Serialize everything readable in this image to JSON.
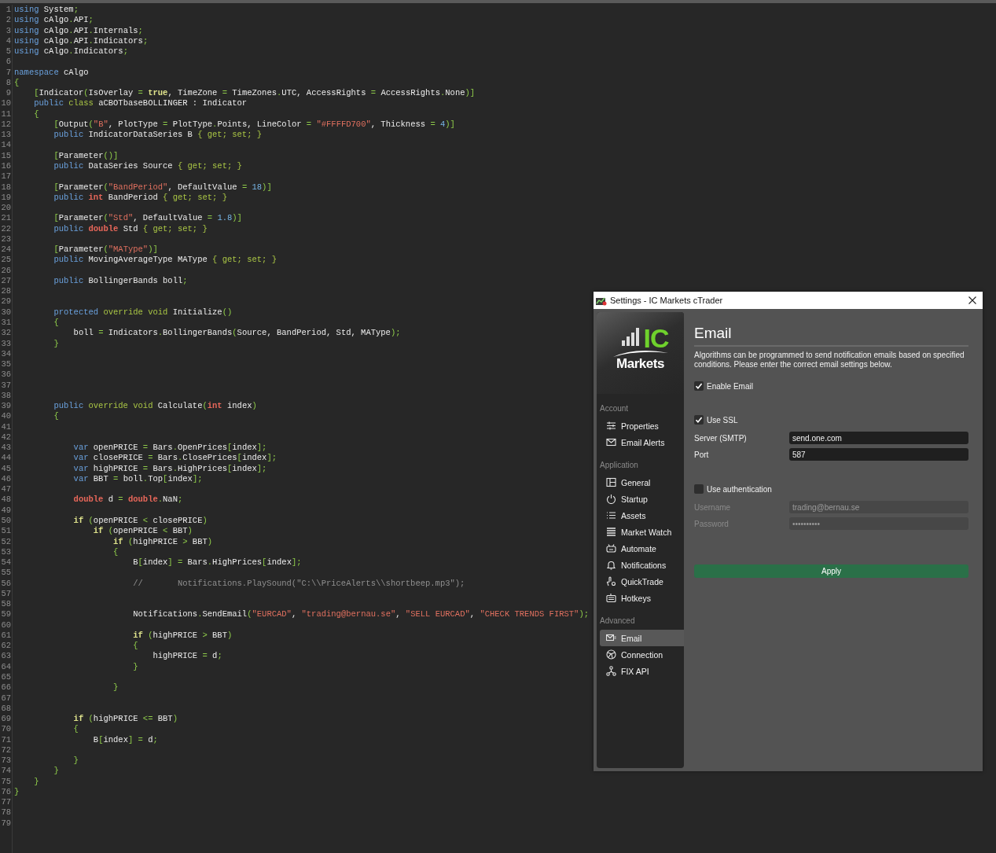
{
  "editor": {
    "lines": [
      {
        "number": "1",
        "segments": [
          {
            "kind": "kw",
            "text": "using"
          },
          {
            "kind": "txt",
            "text": " System"
          },
          {
            "kind": "pun",
            "text": ";"
          }
        ]
      },
      {
        "number": "2",
        "segments": [
          {
            "kind": "kw",
            "text": "using"
          },
          {
            "kind": "txt",
            "text": " cAlgo"
          },
          {
            "kind": "pun",
            "text": "."
          },
          {
            "kind": "txt",
            "text": "API"
          },
          {
            "kind": "pun",
            "text": ";"
          }
        ]
      },
      {
        "number": "3",
        "segments": [
          {
            "kind": "kw",
            "text": "using"
          },
          {
            "kind": "txt",
            "text": " cAlgo"
          },
          {
            "kind": "pun",
            "text": "."
          },
          {
            "kind": "txt",
            "text": "API"
          },
          {
            "kind": "pun",
            "text": "."
          },
          {
            "kind": "txt",
            "text": "Internals"
          },
          {
            "kind": "pun",
            "text": ";"
          }
        ]
      },
      {
        "number": "4",
        "segments": [
          {
            "kind": "kw",
            "text": "using"
          },
          {
            "kind": "txt",
            "text": " cAlgo"
          },
          {
            "kind": "pun",
            "text": "."
          },
          {
            "kind": "txt",
            "text": "API"
          },
          {
            "kind": "pun",
            "text": "."
          },
          {
            "kind": "txt",
            "text": "Indicators"
          },
          {
            "kind": "pun",
            "text": ";"
          }
        ]
      },
      {
        "number": "5",
        "segments": [
          {
            "kind": "kw",
            "text": "using"
          },
          {
            "kind": "txt",
            "text": " cAlgo"
          },
          {
            "kind": "pun",
            "text": "."
          },
          {
            "kind": "txt",
            "text": "Indicators"
          },
          {
            "kind": "pun",
            "text": ";"
          }
        ]
      },
      {
        "number": "6"
      },
      {
        "number": "7",
        "segments": [
          {
            "kind": "kw",
            "text": "namespace"
          },
          {
            "kind": "txt",
            "text": " cAlgo"
          }
        ]
      },
      {
        "number": "8",
        "segments": [
          {
            "kind": "pun",
            "text": "{"
          }
        ]
      },
      {
        "number": "9",
        "segments": [
          {
            "kind": "pun",
            "text": "    ["
          },
          {
            "kind": "txt",
            "text": "Indicator"
          },
          {
            "kind": "pun",
            "text": "("
          },
          {
            "kind": "txt",
            "text": "IsOverlay "
          },
          {
            "kind": "pun",
            "text": "= "
          },
          {
            "kind": "ctl",
            "text": "true"
          },
          {
            "kind": "txt",
            "text": ", TimeZone "
          },
          {
            "kind": "pun",
            "text": "="
          },
          {
            "kind": "txt",
            "text": " TimeZones"
          },
          {
            "kind": "pun",
            "text": "."
          },
          {
            "kind": "txt",
            "text": "UTC, AccessRights "
          },
          {
            "kind": "pun",
            "text": "="
          },
          {
            "kind": "txt",
            "text": " AccessRights"
          },
          {
            "kind": "pun",
            "text": "."
          },
          {
            "kind": "txt",
            "text": "None"
          },
          {
            "kind": "pun",
            "text": ")]"
          }
        ]
      },
      {
        "number": "10",
        "segments": [
          {
            "kind": "kw",
            "text": "    public "
          },
          {
            "kind": "kw2",
            "text": "class"
          },
          {
            "kind": "txt",
            "text": " aCBOTbaseBOLLINGER : Indicator"
          }
        ]
      },
      {
        "number": "11",
        "segments": [
          {
            "kind": "pun",
            "text": "    {"
          }
        ]
      },
      {
        "number": "12",
        "segments": [
          {
            "kind": "pun",
            "text": "        ["
          },
          {
            "kind": "txt",
            "text": "Output"
          },
          {
            "kind": "pun",
            "text": "("
          },
          {
            "kind": "str",
            "text": "\"B\""
          },
          {
            "kind": "txt",
            "text": ", PlotType "
          },
          {
            "kind": "pun",
            "text": "="
          },
          {
            "kind": "txt",
            "text": " PlotType"
          },
          {
            "kind": "pun",
            "text": "."
          },
          {
            "kind": "txt",
            "text": "Points, LineColor "
          },
          {
            "kind": "pun",
            "text": "= "
          },
          {
            "kind": "str",
            "text": "\"#FFFFD700\""
          },
          {
            "kind": "txt",
            "text": ", Thickness "
          },
          {
            "kind": "pun",
            "text": "= "
          },
          {
            "kind": "num",
            "text": "4"
          },
          {
            "kind": "pun",
            "text": ")]"
          }
        ]
      },
      {
        "number": "13",
        "segments": [
          {
            "kind": "kw",
            "text": "        public"
          },
          {
            "kind": "txt",
            "text": " IndicatorDataSeries B "
          },
          {
            "kind": "kw2",
            "text": "{ get; set; }"
          }
        ]
      },
      {
        "number": "14"
      },
      {
        "number": "15",
        "segments": [
          {
            "kind": "pun",
            "text": "        ["
          },
          {
            "kind": "txt",
            "text": "Parameter"
          },
          {
            "kind": "pun",
            "text": "()]"
          }
        ]
      },
      {
        "number": "16",
        "segments": [
          {
            "kind": "kw",
            "text": "        public"
          },
          {
            "kind": "txt",
            "text": " DataSeries Source "
          },
          {
            "kind": "kw2",
            "text": "{ get; set; }"
          }
        ]
      },
      {
        "number": "17"
      },
      {
        "number": "18",
        "segments": [
          {
            "kind": "pun",
            "text": "        ["
          },
          {
            "kind": "txt",
            "text": "Parameter"
          },
          {
            "kind": "pun",
            "text": "("
          },
          {
            "kind": "str",
            "text": "\"BandPeriod\""
          },
          {
            "kind": "txt",
            "text": ", DefaultValue "
          },
          {
            "kind": "pun",
            "text": "= "
          },
          {
            "kind": "num",
            "text": "18"
          },
          {
            "kind": "pun",
            "text": ")]"
          }
        ]
      },
      {
        "number": "19",
        "segments": [
          {
            "kind": "kw",
            "text": "        public "
          },
          {
            "kind": "type",
            "text": "int"
          },
          {
            "kind": "txt",
            "text": " BandPeriod "
          },
          {
            "kind": "kw2",
            "text": "{ get; set; }"
          }
        ]
      },
      {
        "number": "20"
      },
      {
        "number": "21",
        "segments": [
          {
            "kind": "pun",
            "text": "        ["
          },
          {
            "kind": "txt",
            "text": "Parameter"
          },
          {
            "kind": "pun",
            "text": "("
          },
          {
            "kind": "str",
            "text": "\"Std\""
          },
          {
            "kind": "txt",
            "text": ", DefaultValue "
          },
          {
            "kind": "pun",
            "text": "= "
          },
          {
            "kind": "num",
            "text": "1.8"
          },
          {
            "kind": "pun",
            "text": ")]"
          }
        ]
      },
      {
        "number": "22",
        "segments": [
          {
            "kind": "kw",
            "text": "        public "
          },
          {
            "kind": "type",
            "text": "double"
          },
          {
            "kind": "txt",
            "text": " Std "
          },
          {
            "kind": "kw2",
            "text": "{ get; set; }"
          }
        ]
      },
      {
        "number": "23"
      },
      {
        "number": "24",
        "segments": [
          {
            "kind": "pun",
            "text": "        ["
          },
          {
            "kind": "txt",
            "text": "Parameter"
          },
          {
            "kind": "pun",
            "text": "("
          },
          {
            "kind": "str",
            "text": "\"MAType\""
          },
          {
            "kind": "pun",
            "text": ")]"
          }
        ]
      },
      {
        "number": "25",
        "segments": [
          {
            "kind": "kw",
            "text": "        public"
          },
          {
            "kind": "txt",
            "text": " MovingAverageType MAType "
          },
          {
            "kind": "kw2",
            "text": "{ get; set; }"
          }
        ]
      },
      {
        "number": "26"
      },
      {
        "number": "27",
        "segments": [
          {
            "kind": "kw",
            "text": "        public"
          },
          {
            "kind": "txt",
            "text": " BollingerBands boll"
          },
          {
            "kind": "pun",
            "text": ";"
          }
        ]
      },
      {
        "number": "28"
      },
      {
        "number": "29"
      },
      {
        "number": "30",
        "segments": [
          {
            "kind": "kw",
            "text": "        protected "
          },
          {
            "kind": "kw2",
            "text": "override void"
          },
          {
            "kind": "txt",
            "text": " Initialize"
          },
          {
            "kind": "pun",
            "text": "()"
          }
        ]
      },
      {
        "number": "31",
        "segments": [
          {
            "kind": "pun",
            "text": "        {"
          }
        ]
      },
      {
        "number": "32",
        "segments": [
          {
            "kind": "txt",
            "text": "            boll "
          },
          {
            "kind": "pun",
            "text": "="
          },
          {
            "kind": "txt",
            "text": " Indicators"
          },
          {
            "kind": "pun",
            "text": "."
          },
          {
            "kind": "txt",
            "text": "BollingerBands"
          },
          {
            "kind": "pun",
            "text": "("
          },
          {
            "kind": "txt",
            "text": "Source, BandPeriod, Std, MAType"
          },
          {
            "kind": "pun",
            "text": ");"
          }
        ]
      },
      {
        "number": "33",
        "segments": [
          {
            "kind": "pun",
            "text": "        }"
          }
        ]
      },
      {
        "number": "34"
      },
      {
        "number": "35"
      },
      {
        "number": "36"
      },
      {
        "number": "37"
      },
      {
        "number": "38"
      },
      {
        "number": "39",
        "segments": [
          {
            "kind": "kw",
            "text": "        public "
          },
          {
            "kind": "kw2",
            "text": "override void"
          },
          {
            "kind": "txt",
            "text": " Calculate"
          },
          {
            "kind": "pun",
            "text": "("
          },
          {
            "kind": "type",
            "text": "int"
          },
          {
            "kind": "txt",
            "text": " index"
          },
          {
            "kind": "pun",
            "text": ")"
          }
        ]
      },
      {
        "number": "40",
        "segments": [
          {
            "kind": "pun",
            "text": "        {"
          }
        ]
      },
      {
        "number": "41"
      },
      {
        "number": "42"
      },
      {
        "number": "43",
        "segments": [
          {
            "kind": "kw",
            "text": "            var"
          },
          {
            "kind": "txt",
            "text": " openPRICE "
          },
          {
            "kind": "pun",
            "text": "="
          },
          {
            "kind": "txt",
            "text": " Bars"
          },
          {
            "kind": "pun",
            "text": "."
          },
          {
            "kind": "txt",
            "text": "OpenPrices"
          },
          {
            "kind": "pun",
            "text": "["
          },
          {
            "kind": "txt",
            "text": "index"
          },
          {
            "kind": "pun",
            "text": "];"
          }
        ]
      },
      {
        "number": "44",
        "segments": [
          {
            "kind": "kw",
            "text": "            var"
          },
          {
            "kind": "txt",
            "text": " closePRICE "
          },
          {
            "kind": "pun",
            "text": "="
          },
          {
            "kind": "txt",
            "text": " Bars"
          },
          {
            "kind": "pun",
            "text": "."
          },
          {
            "kind": "txt",
            "text": "ClosePrices"
          },
          {
            "kind": "pun",
            "text": "["
          },
          {
            "kind": "txt",
            "text": "index"
          },
          {
            "kind": "pun",
            "text": "];"
          }
        ]
      },
      {
        "number": "45",
        "segments": [
          {
            "kind": "kw",
            "text": "            var"
          },
          {
            "kind": "txt",
            "text": " highPRICE "
          },
          {
            "kind": "pun",
            "text": "="
          },
          {
            "kind": "txt",
            "text": " Bars"
          },
          {
            "kind": "pun",
            "text": "."
          },
          {
            "kind": "txt",
            "text": "HighPrices"
          },
          {
            "kind": "pun",
            "text": "["
          },
          {
            "kind": "txt",
            "text": "index"
          },
          {
            "kind": "pun",
            "text": "];"
          }
        ]
      },
      {
        "number": "46",
        "segments": [
          {
            "kind": "kw",
            "text": "            var"
          },
          {
            "kind": "txt",
            "text": " BBT "
          },
          {
            "kind": "pun",
            "text": "="
          },
          {
            "kind": "txt",
            "text": " boll"
          },
          {
            "kind": "pun",
            "text": "."
          },
          {
            "kind": "txt",
            "text": "Top"
          },
          {
            "kind": "pun",
            "text": "["
          },
          {
            "kind": "txt",
            "text": "index"
          },
          {
            "kind": "pun",
            "text": "];"
          }
        ]
      },
      {
        "number": "47"
      },
      {
        "number": "48",
        "segments": [
          {
            "kind": "type",
            "text": "            double"
          },
          {
            "kind": "txt",
            "text": " d "
          },
          {
            "kind": "pun",
            "text": "= "
          },
          {
            "kind": "type",
            "text": "double"
          },
          {
            "kind": "pun",
            "text": "."
          },
          {
            "kind": "txt",
            "text": "NaN"
          },
          {
            "kind": "pun",
            "text": ";"
          }
        ]
      },
      {
        "number": "49"
      },
      {
        "number": "50",
        "segments": [
          {
            "kind": "ctl",
            "text": "            if"
          },
          {
            "kind": "pun",
            "text": " ("
          },
          {
            "kind": "txt",
            "text": "openPRICE "
          },
          {
            "kind": "pun",
            "text": "<"
          },
          {
            "kind": "txt",
            "text": " closePRICE"
          },
          {
            "kind": "pun",
            "text": ")"
          }
        ]
      },
      {
        "number": "51",
        "segments": [
          {
            "kind": "ctl",
            "text": "                if"
          },
          {
            "kind": "pun",
            "text": " ("
          },
          {
            "kind": "txt",
            "text": "openPRICE "
          },
          {
            "kind": "pun",
            "text": "<"
          },
          {
            "kind": "txt",
            "text": " BBT"
          },
          {
            "kind": "pun",
            "text": ")"
          }
        ]
      },
      {
        "number": "52",
        "segments": [
          {
            "kind": "ctl",
            "text": "                    if"
          },
          {
            "kind": "pun",
            "text": " ("
          },
          {
            "kind": "txt",
            "text": "highPRICE "
          },
          {
            "kind": "pun",
            "text": ">"
          },
          {
            "kind": "txt",
            "text": " BBT"
          },
          {
            "kind": "pun",
            "text": ")"
          }
        ]
      },
      {
        "number": "53",
        "segments": [
          {
            "kind": "pun",
            "text": "                    {"
          }
        ]
      },
      {
        "number": "54",
        "segments": [
          {
            "kind": "txt",
            "text": "                        B"
          },
          {
            "kind": "pun",
            "text": "["
          },
          {
            "kind": "txt",
            "text": "index"
          },
          {
            "kind": "pun",
            "text": "] ="
          },
          {
            "kind": "txt",
            "text": " Bars"
          },
          {
            "kind": "pun",
            "text": "."
          },
          {
            "kind": "txt",
            "text": "HighPrices"
          },
          {
            "kind": "pun",
            "text": "["
          },
          {
            "kind": "txt",
            "text": "index"
          },
          {
            "kind": "pun",
            "text": "];"
          }
        ]
      },
      {
        "number": "55"
      },
      {
        "number": "56",
        "segments": [
          {
            "kind": "cmt",
            "text": "                        //       Notifications.PlaySound(\"C:\\\\PriceAlerts\\\\shortbeep.mp3\");"
          }
        ]
      },
      {
        "number": "57"
      },
      {
        "number": "58"
      },
      {
        "number": "59",
        "segments": [
          {
            "kind": "txt",
            "text": "                        Notifications"
          },
          {
            "kind": "pun",
            "text": "."
          },
          {
            "kind": "txt",
            "text": "SendEmail"
          },
          {
            "kind": "pun",
            "text": "("
          },
          {
            "kind": "str",
            "text": "\"EURCAD\""
          },
          {
            "kind": "txt",
            "text": ", "
          },
          {
            "kind": "str",
            "text": "\"trading@bernau.se\""
          },
          {
            "kind": "txt",
            "text": ", "
          },
          {
            "kind": "str",
            "text": "\"SELL EURCAD\""
          },
          {
            "kind": "txt",
            "text": ", "
          },
          {
            "kind": "str",
            "text": "\"CHECK TRENDS FIRST\""
          },
          {
            "kind": "pun",
            "text": ");"
          }
        ]
      },
      {
        "number": "60"
      },
      {
        "number": "61",
        "segments": [
          {
            "kind": "ctl",
            "text": "                        if"
          },
          {
            "kind": "pun",
            "text": " ("
          },
          {
            "kind": "txt",
            "text": "highPRICE "
          },
          {
            "kind": "pun",
            "text": ">"
          },
          {
            "kind": "txt",
            "text": " BBT"
          },
          {
            "kind": "pun",
            "text": ")"
          }
        ]
      },
      {
        "number": "62",
        "segments": [
          {
            "kind": "pun",
            "text": "                        {"
          }
        ]
      },
      {
        "number": "63",
        "segments": [
          {
            "kind": "txt",
            "text": "                            highPRICE "
          },
          {
            "kind": "pun",
            "text": "="
          },
          {
            "kind": "txt",
            "text": " d"
          },
          {
            "kind": "pun",
            "text": ";"
          }
        ]
      },
      {
        "number": "64",
        "segments": [
          {
            "kind": "pun",
            "text": "                        }"
          }
        ]
      },
      {
        "number": "65"
      },
      {
        "number": "66",
        "segments": [
          {
            "kind": "pun",
            "text": "                    }"
          }
        ]
      },
      {
        "number": "67"
      },
      {
        "number": "68"
      },
      {
        "number": "69",
        "segments": [
          {
            "kind": "ctl",
            "text": "            if"
          },
          {
            "kind": "pun",
            "text": " ("
          },
          {
            "kind": "txt",
            "text": "highPRICE "
          },
          {
            "kind": "pun",
            "text": "<="
          },
          {
            "kind": "txt",
            "text": " BBT"
          },
          {
            "kind": "pun",
            "text": ")"
          }
        ]
      },
      {
        "number": "70",
        "segments": [
          {
            "kind": "pun",
            "text": "            {"
          }
        ]
      },
      {
        "number": "71",
        "segments": [
          {
            "kind": "txt",
            "text": "                B"
          },
          {
            "kind": "pun",
            "text": "["
          },
          {
            "kind": "txt",
            "text": "index"
          },
          {
            "kind": "pun",
            "text": "] ="
          },
          {
            "kind": "txt",
            "text": " d"
          },
          {
            "kind": "pun",
            "text": ";"
          }
        ]
      },
      {
        "number": "72"
      },
      {
        "number": "73",
        "segments": [
          {
            "kind": "pun",
            "text": "            }"
          }
        ]
      },
      {
        "number": "74",
        "segments": [
          {
            "kind": "pun",
            "text": "        }"
          }
        ]
      },
      {
        "number": "75",
        "segments": [
          {
            "kind": "pun",
            "text": "    }"
          }
        ]
      },
      {
        "number": "76",
        "segments": [
          {
            "kind": "pun",
            "text": "}"
          }
        ]
      },
      {
        "number": "77"
      },
      {
        "number": "78"
      },
      {
        "number": "79"
      }
    ]
  },
  "dialog": {
    "title": "Settings - IC Markets cTrader",
    "sidebar": {
      "logo": {
        "mark": "IC",
        "name": "Markets"
      },
      "sections": [
        {
          "title": "Account",
          "items": [
            {
              "label": "Properties",
              "selected": false
            },
            {
              "label": "Email Alerts",
              "selected": false
            }
          ]
        },
        {
          "title": "Application",
          "items": [
            {
              "label": "General",
              "selected": false
            },
            {
              "label": "Startup",
              "selected": false
            },
            {
              "label": "Assets",
              "selected": false
            },
            {
              "label": "Market Watch",
              "selected": false
            },
            {
              "label": "Automate",
              "selected": false
            },
            {
              "label": "Notifications",
              "selected": false
            },
            {
              "label": "QuickTrade",
              "selected": false
            },
            {
              "label": "Hotkeys",
              "selected": false
            }
          ]
        },
        {
          "title": "Advanced",
          "items": [
            {
              "label": "Email",
              "selected": true
            },
            {
              "label": "Connection",
              "selected": false
            },
            {
              "label": "FIX API",
              "selected": false
            }
          ]
        }
      ]
    },
    "form": {
      "heading": "Email",
      "description": "Algorithms can be programmed to send notification emails based on specified conditions. Please enter the correct email settings below.",
      "controls": [
        {
          "kind": "checkbox",
          "label": "Enable Email",
          "checked": true
        },
        {
          "kind": "checkbox",
          "label": "Use SSL",
          "checked": true
        },
        {
          "kind": "field",
          "label": "Server (SMTP)",
          "value": "send.one.com",
          "disabled": false
        },
        {
          "kind": "field",
          "label": "Port",
          "value": "587",
          "disabled": false
        },
        {
          "kind": "checkbox",
          "label": "Use authentication",
          "checked": false
        },
        {
          "kind": "field",
          "label": "Username",
          "value": "trading@bernau.se",
          "disabled": true
        },
        {
          "kind": "field",
          "label": "Password",
          "value": "••••••••••",
          "disabled": true
        }
      ],
      "apply": "Apply"
    }
  }
}
